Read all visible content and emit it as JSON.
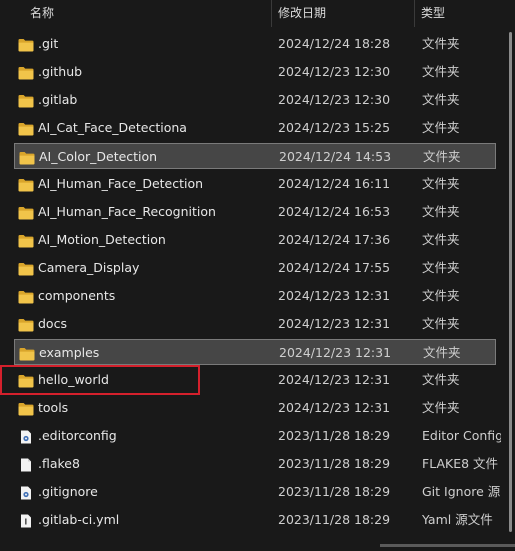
{
  "header": {
    "name_label": "名称",
    "date_label": "修改日期",
    "type_label": "类型"
  },
  "rows": [
    {
      "name": ".git",
      "date": "2024/12/24 18:28",
      "type": "文件夹",
      "icon": "folder-icon"
    },
    {
      "name": ".github",
      "date": "2024/12/23 12:30",
      "type": "文件夹",
      "icon": "folder-icon"
    },
    {
      "name": ".gitlab",
      "date": "2024/12/23 12:30",
      "type": "文件夹",
      "icon": "folder-icon"
    },
    {
      "name": "AI_Cat_Face_Detectiona",
      "date": "2024/12/23 15:25",
      "type": "文件夹",
      "icon": "folder-icon"
    },
    {
      "name": "AI_Color_Detection",
      "date": "2024/12/24 14:53",
      "type": "文件夹",
      "icon": "folder-icon",
      "state": "selected"
    },
    {
      "name": "AI_Human_Face_Detection",
      "date": "2024/12/24 16:11",
      "type": "文件夹",
      "icon": "folder-icon"
    },
    {
      "name": "AI_Human_Face_Recognition",
      "date": "2024/12/24 16:53",
      "type": "文件夹",
      "icon": "folder-icon"
    },
    {
      "name": "AI_Motion_Detection",
      "date": "2024/12/24 17:36",
      "type": "文件夹",
      "icon": "folder-icon"
    },
    {
      "name": "Camera_Display",
      "date": "2024/12/24 17:55",
      "type": "文件夹",
      "icon": "folder-icon"
    },
    {
      "name": "components",
      "date": "2024/12/23 12:31",
      "type": "文件夹",
      "icon": "folder-icon"
    },
    {
      "name": "docs",
      "date": "2024/12/23 12:31",
      "type": "文件夹",
      "icon": "folder-icon"
    },
    {
      "name": "examples",
      "date": "2024/12/23 12:31",
      "type": "文件夹",
      "icon": "folder-icon",
      "state": "selected"
    },
    {
      "name": "hello_world",
      "date": "2024/12/23 12:31",
      "type": "文件夹",
      "icon": "folder-icon",
      "state": "highlighted-red"
    },
    {
      "name": "tools",
      "date": "2024/12/23 12:31",
      "type": "文件夹",
      "icon": "folder-icon"
    },
    {
      "name": ".editorconfig",
      "date": "2023/11/28 18:29",
      "type": "Editor Config",
      "icon": "config-file-icon"
    },
    {
      "name": ".flake8",
      "date": "2023/11/28 18:29",
      "type": "FLAKE8 文件",
      "icon": "blank-file-icon"
    },
    {
      "name": ".gitignore",
      "date": "2023/11/28 18:29",
      "type": "Git Ignore 源",
      "icon": "config-file-icon"
    },
    {
      "name": ".gitlab-ci.yml",
      "date": "2023/11/28 18:29",
      "type": "Yaml 源文件",
      "icon": "text-file-icon"
    }
  ],
  "colors": {
    "background": "#191919",
    "selection": "#464646",
    "folder": "#e8b83c",
    "highlight_red": "#d4202c"
  }
}
